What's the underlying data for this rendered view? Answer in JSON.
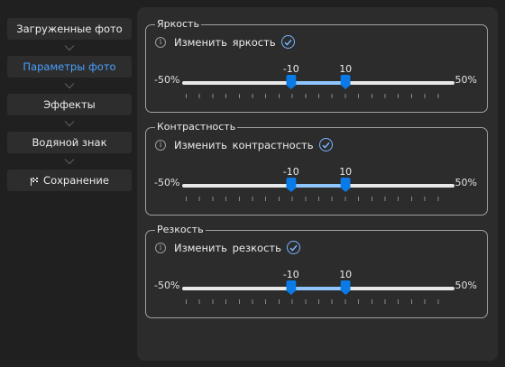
{
  "sidebar": {
    "steps": [
      {
        "label": "Загруженные фото",
        "active": false
      },
      {
        "label": "Параметры фото",
        "active": true
      },
      {
        "label": "Эффекты",
        "active": false
      },
      {
        "label": "Водяной знак",
        "active": false
      },
      {
        "label": "Сохранение",
        "active": false,
        "icon": "checkered-flag-icon"
      }
    ]
  },
  "groups": [
    {
      "title": "Яркость",
      "checkbox_label": "Изменить  яркость",
      "checked": true,
      "min_label": "-50%",
      "max_label": "50%",
      "range_min": -50,
      "range_max": 50,
      "low": -10,
      "high": 10,
      "low_label": "-10",
      "high_label": "10"
    },
    {
      "title": "Контрастность",
      "checkbox_label": "Изменить  контрастность",
      "checked": true,
      "min_label": "-50%",
      "max_label": "50%",
      "range_min": -50,
      "range_max": 50,
      "low": -10,
      "high": 10,
      "low_label": "-10",
      "high_label": "10"
    },
    {
      "title": "Резкость",
      "checkbox_label": "Изменить  резкость",
      "checked": true,
      "min_label": "-50%",
      "max_label": "50%",
      "range_min": -50,
      "range_max": 50,
      "low": -10,
      "high": 10,
      "low_label": "-10",
      "high_label": "10"
    }
  ],
  "colors": {
    "accent": "#4aa0ff",
    "thumb": "#0a7ae6",
    "range_fill": "#8fc6ff"
  }
}
